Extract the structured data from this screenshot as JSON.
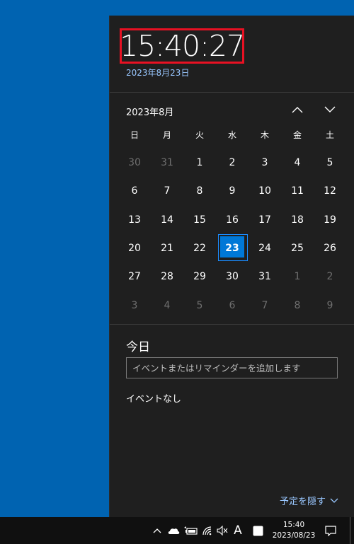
{
  "flyout": {
    "clock_time": "15:40:27",
    "clock_date": "2023年8月23日",
    "month_label": "2023年8月",
    "nav": {
      "prev_icon": "chevron-up-icon",
      "next_icon": "chevron-down-icon"
    },
    "weekdays": [
      "日",
      "月",
      "火",
      "水",
      "木",
      "金",
      "土"
    ],
    "days": [
      {
        "label": "30",
        "other": true
      },
      {
        "label": "31",
        "other": true
      },
      {
        "label": "1"
      },
      {
        "label": "2"
      },
      {
        "label": "3"
      },
      {
        "label": "4"
      },
      {
        "label": "5"
      },
      {
        "label": "6"
      },
      {
        "label": "7"
      },
      {
        "label": "8"
      },
      {
        "label": "9"
      },
      {
        "label": "10"
      },
      {
        "label": "11"
      },
      {
        "label": "12"
      },
      {
        "label": "13"
      },
      {
        "label": "14"
      },
      {
        "label": "15"
      },
      {
        "label": "16"
      },
      {
        "label": "17"
      },
      {
        "label": "18"
      },
      {
        "label": "19"
      },
      {
        "label": "20"
      },
      {
        "label": "21"
      },
      {
        "label": "22"
      },
      {
        "label": "23",
        "today": true
      },
      {
        "label": "24"
      },
      {
        "label": "25"
      },
      {
        "label": "26"
      },
      {
        "label": "27"
      },
      {
        "label": "28"
      },
      {
        "label": "29"
      },
      {
        "label": "30"
      },
      {
        "label": "31"
      },
      {
        "label": "1",
        "other": true
      },
      {
        "label": "2",
        "other": true
      },
      {
        "label": "3",
        "other": true
      },
      {
        "label": "4",
        "other": true
      },
      {
        "label": "5",
        "other": true
      },
      {
        "label": "6",
        "other": true
      },
      {
        "label": "7",
        "other": true
      },
      {
        "label": "8",
        "other": true
      },
      {
        "label": "9",
        "other": true
      }
    ],
    "agenda_title": "今日",
    "event_placeholder": "イベントまたはリマインダーを追加します",
    "no_events": "イベントなし",
    "hide_agenda_label": "予定を隠す"
  },
  "taskbar": {
    "ime_label": "A",
    "clock_time": "15:40",
    "clock_date": "2023/08/23",
    "tray_icons": [
      "chevron-up-icon",
      "onedrive-cloud-icon",
      "battery-icon",
      "wifi-icon",
      "volume-muted-icon",
      "ime-icon",
      "app-tray-icon",
      "notification-icon"
    ]
  },
  "colors": {
    "desktop": "#0063b1",
    "flyout_bg": "#1f1f1f",
    "accent": "#0078d7",
    "link": "#99c7ff",
    "highlight_border": "#e81123"
  }
}
